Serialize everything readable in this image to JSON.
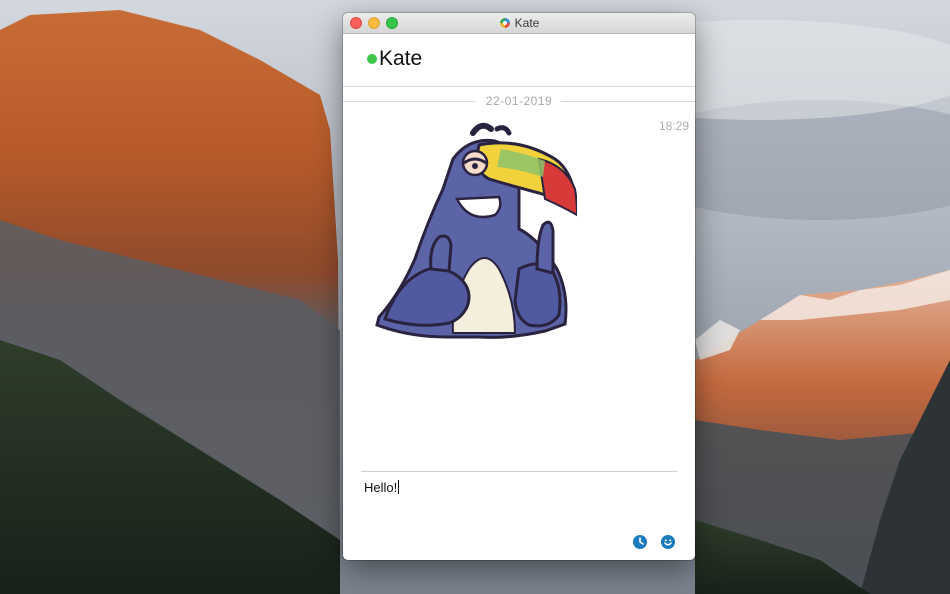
{
  "window": {
    "title": "Kate",
    "app_icon": "app-logo-icon"
  },
  "header": {
    "contact_name": "Kate",
    "presence_color": "#3ec84b"
  },
  "chat": {
    "date_separator": "22-01-2019",
    "messages": [
      {
        "type": "sticker",
        "sticker_icon": "toucan-thumbs-up-sticker",
        "time": "18:29"
      }
    ]
  },
  "composer": {
    "text": "Hello!",
    "tools": [
      {
        "icon": "clock-icon",
        "color": "#1a7bbf"
      },
      {
        "icon": "smile-icon",
        "color": "#1a7bbf"
      }
    ]
  }
}
